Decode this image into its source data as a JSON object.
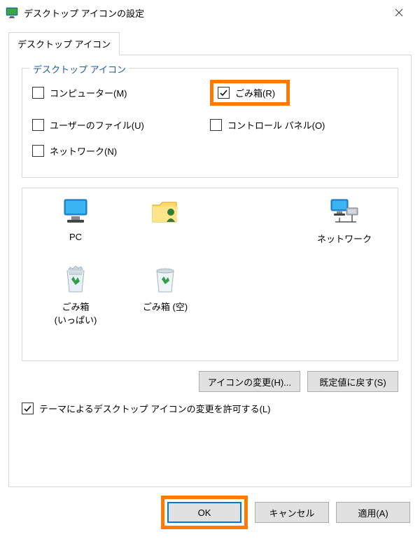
{
  "title": "デスクトップ アイコンの設定",
  "tab_label": "デスクトップ アイコン",
  "fieldset_legend": "デスクトップ アイコン",
  "checkboxes": {
    "computer": {
      "label": "コンピューター(M)",
      "checked": false
    },
    "recycle": {
      "label": "ごみ箱(R)",
      "checked": true
    },
    "userfiles": {
      "label": "ユーザーのファイル(U)",
      "checked": false
    },
    "cpanel": {
      "label": "コントロール パネル(O)",
      "checked": false
    },
    "network": {
      "label": "ネットワーク(N)",
      "checked": false
    }
  },
  "icons": {
    "pc": "PC",
    "network": "ネットワーク",
    "recycle_full": "ごみ箱 (いっぱい)",
    "recycle_empty": "ごみ箱 (空)"
  },
  "buttons": {
    "change_icon": "アイコンの変更(H)...",
    "restore_default": "既定値に戻す(S)",
    "ok": "OK",
    "cancel": "キャンセル",
    "apply": "適用(A)"
  },
  "allow_theme_label": "テーマによるデスクトップ アイコンの変更を許可する(L)",
  "allow_theme_checked": true
}
